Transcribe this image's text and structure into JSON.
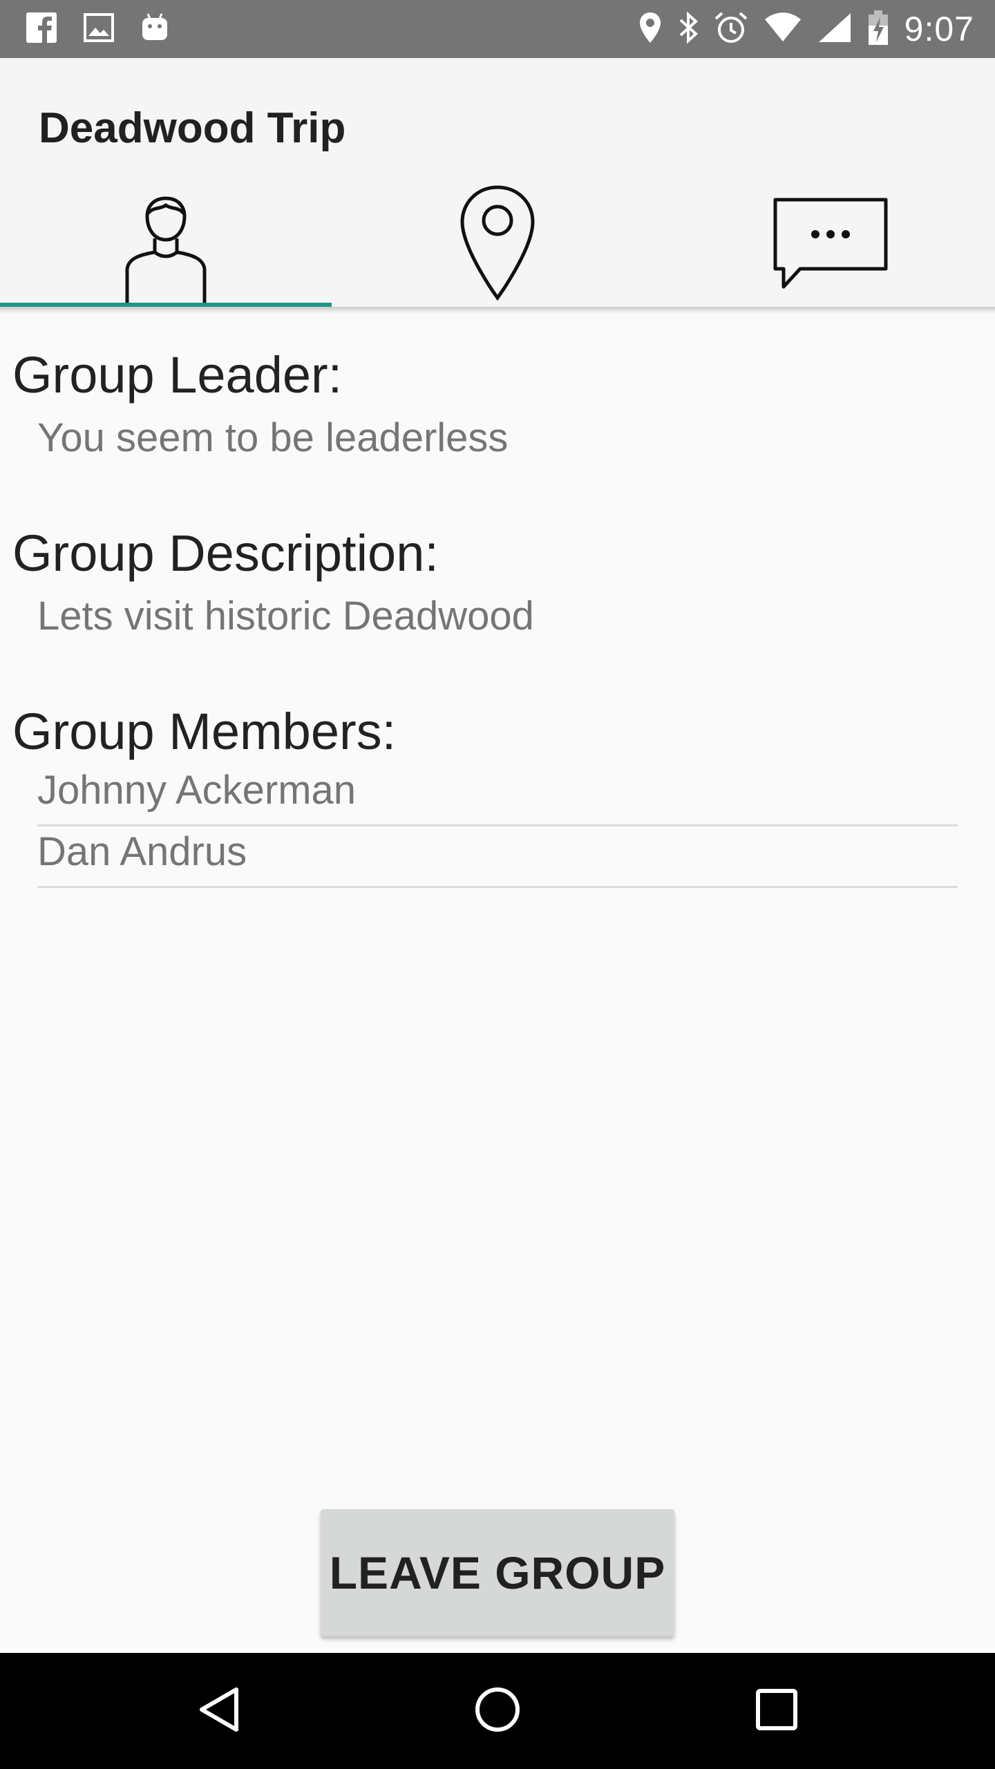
{
  "status_bar": {
    "time": "9:07",
    "left_icons": [
      "facebook-icon",
      "image-icon",
      "android-icon"
    ],
    "right_icons": [
      "location-icon",
      "bluetooth-icon",
      "alarm-icon",
      "wifi-icon",
      "signal-icon",
      "battery-icon"
    ]
  },
  "app_bar": {
    "title": "Deadwood Trip",
    "accent_color": "#1f9588",
    "tabs": [
      {
        "icon": "person-icon",
        "active": true
      },
      {
        "icon": "location-pin-icon",
        "active": false
      },
      {
        "icon": "chat-bubble-icon",
        "active": false
      }
    ]
  },
  "group_leader": {
    "heading": "Group Leader:",
    "value": "You seem to be leaderless"
  },
  "group_description": {
    "heading": "Group Description:",
    "value": "Lets visit historic Deadwood"
  },
  "group_members": {
    "heading": "Group Members:",
    "members": [
      "Johnny Ackerman",
      "Dan Andrus"
    ]
  },
  "leave_button": {
    "label": "LEAVE GROUP"
  },
  "nav_bar": {
    "buttons": [
      "back-icon",
      "home-icon",
      "recents-icon"
    ]
  }
}
